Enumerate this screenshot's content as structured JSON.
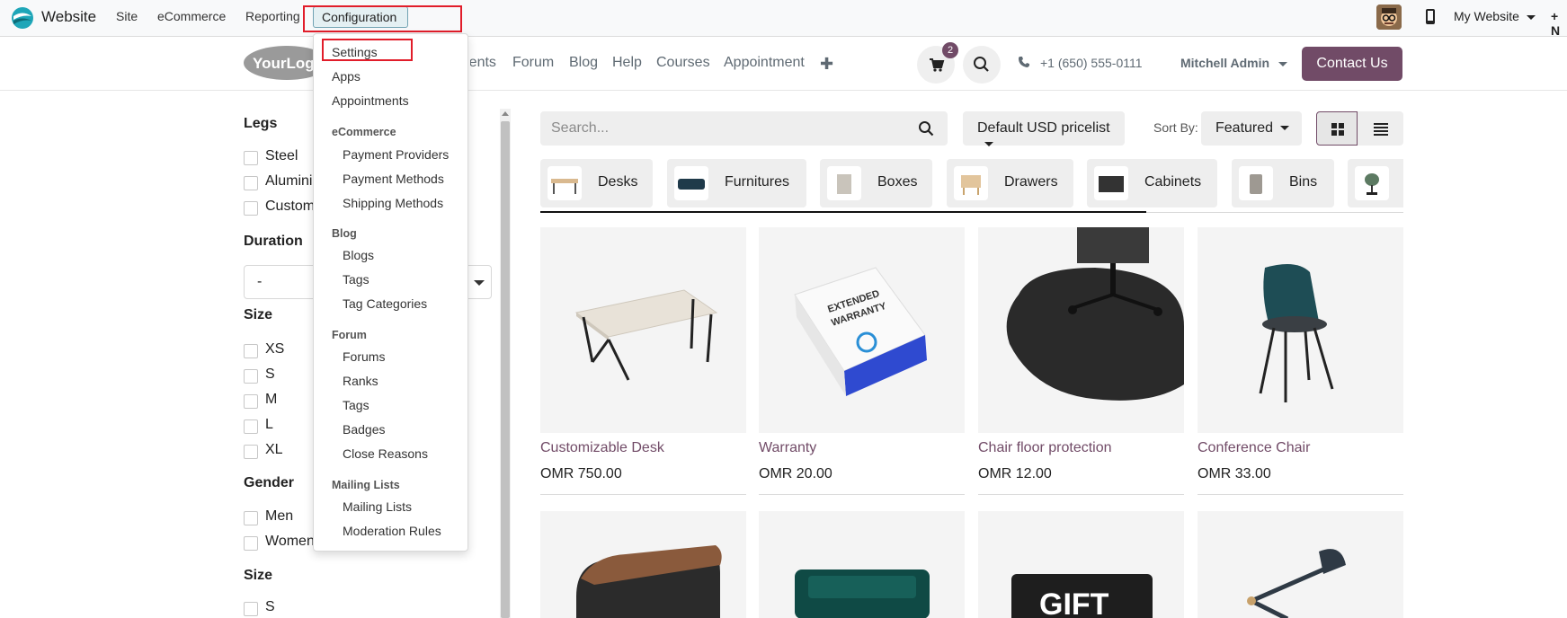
{
  "topbar": {
    "app_name": "Website",
    "menu": [
      "Site",
      "eCommerce",
      "Reporting"
    ],
    "active_menu": "Configuration",
    "my_website": "My Website",
    "new_label": "+ N"
  },
  "header": {
    "logo_text": "YourLogo",
    "nav": [
      "Events",
      "Forum",
      "Blog",
      "Help",
      "Courses",
      "Appointment"
    ],
    "cart_count": "2",
    "phone": "+1 (650) 555-0111",
    "user": "Mitchell Admin",
    "contact_button": "Contact Us"
  },
  "dropdown": {
    "top_items": [
      "Settings",
      "Apps",
      "Appointments"
    ],
    "groups": [
      {
        "heading": "eCommerce",
        "items": [
          "Payment Providers",
          "Payment Methods",
          "Shipping Methods"
        ]
      },
      {
        "heading": "Blog",
        "items": [
          "Blogs",
          "Tags",
          "Tag Categories"
        ]
      },
      {
        "heading": "Forum",
        "items": [
          "Forums",
          "Ranks",
          "Tags",
          "Badges",
          "Close Reasons"
        ]
      },
      {
        "heading": "Mailing Lists",
        "items": [
          "Mailing Lists",
          "Moderation Rules"
        ]
      }
    ]
  },
  "filters": {
    "legs": {
      "title": "Legs",
      "options": [
        "Steel",
        "Aluminium",
        "Custom"
      ]
    },
    "duration": {
      "title": "Duration",
      "value": "-"
    },
    "size": {
      "title": "Size",
      "options": [
        "XS",
        "S",
        "M",
        "L",
        "XL"
      ]
    },
    "gender": {
      "title": "Gender",
      "options": [
        "Men",
        "Women"
      ]
    },
    "size2": {
      "title": "Size",
      "options": [
        "S"
      ]
    }
  },
  "shop": {
    "search_placeholder": "Search...",
    "pricelist": "Default USD pricelist",
    "sort_label": "Sort By:",
    "sort_value": "Featured",
    "categories": [
      "Desks",
      "Furnitures",
      "Boxes",
      "Drawers",
      "Cabinets",
      "Bins",
      ""
    ],
    "products": [
      {
        "name": "Customizable Desk",
        "price": "OMR 750.00"
      },
      {
        "name": "Warranty",
        "price": "OMR 20.00"
      },
      {
        "name": "Chair floor protection",
        "price": "OMR 12.00"
      },
      {
        "name": "Conference Chair",
        "price": "OMR 33.00"
      }
    ],
    "gift_text": "GIFT"
  },
  "colors": {
    "brand": "#714b67",
    "highlight": "#e11d2a"
  }
}
